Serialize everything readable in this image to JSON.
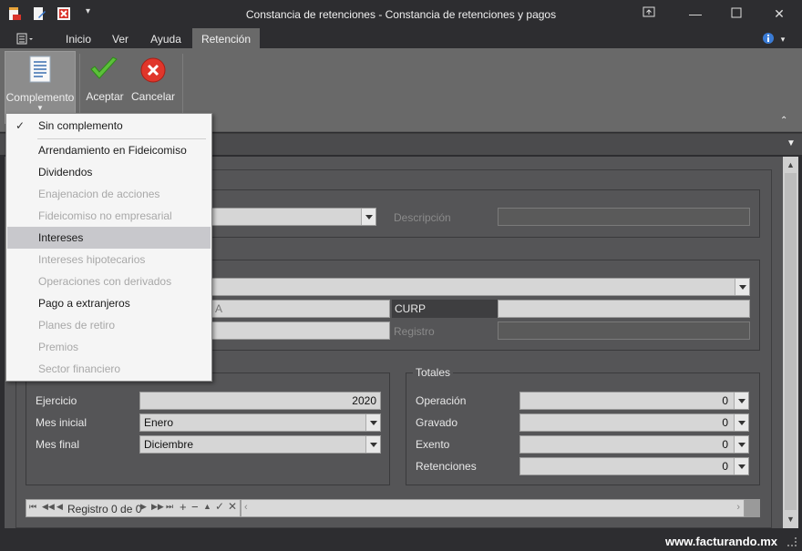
{
  "window": {
    "title": "Constancia de retenciones - Constancia de retenciones y pagos"
  },
  "tabs": [
    "Inicio",
    "Ver",
    "Ayuda",
    "Retención"
  ],
  "ribbon": {
    "complemento_label": "Complemento",
    "aceptar_label": "Aceptar",
    "cancelar_label": "Cancelar"
  },
  "menu": {
    "items": [
      {
        "label": "Sin complemento",
        "checked": true,
        "enabled": true
      },
      {
        "label": "Arrendamiento en Fideicomiso",
        "enabled": true
      },
      {
        "label": "Dividendos",
        "enabled": true
      },
      {
        "label": "Enajenacion de acciones",
        "enabled": false
      },
      {
        "label": "Fideicomiso no empresarial",
        "enabled": false
      },
      {
        "label": "Intereses",
        "enabled": true,
        "highlighted": true
      },
      {
        "label": "Intereses hipotecarios",
        "enabled": false
      },
      {
        "label": "Operaciones con derivados",
        "enabled": false
      },
      {
        "label": "Pago a extranjeros",
        "enabled": true
      },
      {
        "label": "Planes de retiro",
        "enabled": false
      },
      {
        "label": "Premios",
        "enabled": false
      },
      {
        "label": "Sector financiero",
        "enabled": false
      }
    ]
  },
  "form": {
    "descripcion_label": "Descripción",
    "curp_label": "CURP",
    "registro_label": "Registro",
    "partial_a": "A",
    "ejercicio_label": "Ejercicio",
    "ejercicio_value": "2020",
    "mes_inicial_label": "Mes inicial",
    "mes_inicial_value": "Enero",
    "mes_final_label": "Mes final",
    "mes_final_value": "Diciembre"
  },
  "totales": {
    "title": "Totales",
    "operacion_label": "Operación",
    "operacion_value": "0",
    "gravado_label": "Gravado",
    "gravado_value": "0",
    "exento_label": "Exento",
    "exento_value": "0",
    "retenciones_label": "Retenciones",
    "retenciones_value": "0"
  },
  "navigator": {
    "text": "Registro 0 de 0"
  },
  "status": {
    "brand": "www.facturando.mx"
  },
  "colors": {
    "ribbon_bg": "#696969",
    "window_bg": "#2d2d30",
    "menu_highlight": "#c8c8cc"
  }
}
